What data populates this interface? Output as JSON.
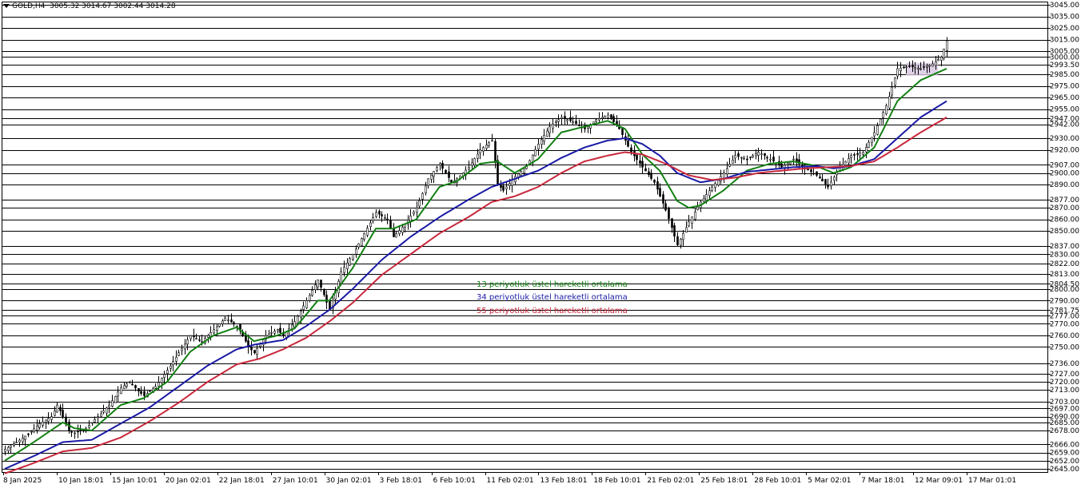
{
  "header": {
    "symbol": "GOLD,H4",
    "ohlc": "3005.32 3014.67 3002.44 3014.28"
  },
  "legend": {
    "ema13": "13 periyotluk üstel hareketli ortalama",
    "ema34": "34 periyotluk üstel hareketli ortalama",
    "ema55": "55 periyotluk üstel hareketli ortalama"
  },
  "colors": {
    "background": "#ffffff",
    "candle": "#000000",
    "ema13": "#138013",
    "ema34": "#1a1aa6",
    "ema55": "#c8283c",
    "highlight_box": "#d7c7e0"
  },
  "chart_data": {
    "type": "line",
    "xlabel": "",
    "ylabel": "",
    "ylim": [
      2645,
      3045
    ],
    "y_tick_labels": [
      "3045.00",
      "3035.00",
      "3025.00",
      "3015.00",
      "3005.00",
      "3000.00",
      "2993.50",
      "2985.00",
      "2975.00",
      "2965.00",
      "2955.00",
      "2947.00",
      "2942.00",
      "2930.00",
      "2920.00",
      "2907.00",
      "2900.00",
      "2890.00",
      "2877.00",
      "2870.00",
      "2860.00",
      "2850.00",
      "2837.00",
      "2830.00",
      "2822.00",
      "2813.00",
      "2804.50",
      "2800.00",
      "2790.00",
      "2781.75",
      "2777.00",
      "2770.00",
      "2760.00",
      "2750.00",
      "2736.00",
      "2727.00",
      "2720.00",
      "2713.00",
      "2703.00",
      "2697.00",
      "2690.00",
      "2685.00",
      "2678.00",
      "2666.00",
      "2659.00",
      "2652.00",
      "2645.00"
    ],
    "hlines": [
      3045,
      3035,
      3025,
      3015,
      3005,
      3000,
      2993.5,
      2985,
      2975,
      2965,
      2955,
      2947,
      2942,
      2930,
      2920,
      2907,
      2900,
      2890,
      2877,
      2870,
      2860,
      2850,
      2837,
      2830,
      2822,
      2813,
      2804.5,
      2800,
      2790,
      2781.75,
      2777,
      2770,
      2760,
      2750,
      2736,
      2727,
      2720,
      2713,
      2703,
      2697,
      2690,
      2685,
      2678,
      2666,
      2659,
      2652,
      2645
    ],
    "x_tick_labels": [
      "8 Jan 2025",
      "10 Jan 18:01",
      "15 Jan 10:01",
      "20 Jan 02:01",
      "22 Jan 18:01",
      "27 Jan 10:01",
      "30 Jan 02:01",
      "3 Feb 18:01",
      "6 Feb 10:01",
      "11 Feb 02:01",
      "13 Feb 18:01",
      "18 Feb 10:01",
      "21 Feb 02:01",
      "25 Feb 18:01",
      "28 Feb 10:01",
      "5 Mar 02:01",
      "7 Mar 18:01",
      "12 Mar 09:01",
      "17 Mar 01:01"
    ],
    "close_anchors": [
      [
        0,
        2662
      ],
      [
        4,
        2668
      ],
      [
        8,
        2675
      ],
      [
        12,
        2684
      ],
      [
        16,
        2690
      ],
      [
        18,
        2700
      ],
      [
        20,
        2690
      ],
      [
        22,
        2678
      ],
      [
        24,
        2676
      ],
      [
        28,
        2680
      ],
      [
        32,
        2690
      ],
      [
        36,
        2700
      ],
      [
        40,
        2715
      ],
      [
        43,
        2720
      ],
      [
        46,
        2712
      ],
      [
        48,
        2708
      ],
      [
        52,
        2716
      ],
      [
        56,
        2730
      ],
      [
        60,
        2745
      ],
      [
        64,
        2760
      ],
      [
        68,
        2755
      ],
      [
        72,
        2765
      ],
      [
        76,
        2775
      ],
      [
        80,
        2768
      ],
      [
        82,
        2760
      ],
      [
        84,
        2750
      ],
      [
        86,
        2745
      ],
      [
        90,
        2760
      ],
      [
        94,
        2765
      ],
      [
        96,
        2760
      ],
      [
        100,
        2772
      ],
      [
        104,
        2790
      ],
      [
        108,
        2808
      ],
      [
        110,
        2795
      ],
      [
        112,
        2782
      ],
      [
        116,
        2815
      ],
      [
        120,
        2830
      ],
      [
        124,
        2848
      ],
      [
        128,
        2866
      ],
      [
        132,
        2860
      ],
      [
        134,
        2845
      ],
      [
        138,
        2856
      ],
      [
        142,
        2870
      ],
      [
        146,
        2895
      ],
      [
        150,
        2908
      ],
      [
        152,
        2900
      ],
      [
        154,
        2892
      ],
      [
        156,
        2895
      ],
      [
        160,
        2905
      ],
      [
        164,
        2920
      ],
      [
        168,
        2928
      ],
      [
        170,
        2890
      ],
      [
        172,
        2885
      ],
      [
        176,
        2897
      ],
      [
        180,
        2906
      ],
      [
        184,
        2925
      ],
      [
        188,
        2940
      ],
      [
        192,
        2948
      ],
      [
        196,
        2944
      ],
      [
        200,
        2938
      ],
      [
        204,
        2946
      ],
      [
        208,
        2950
      ],
      [
        212,
        2938
      ],
      [
        216,
        2918
      ],
      [
        220,
        2905
      ],
      [
        224,
        2892
      ],
      [
        228,
        2868
      ],
      [
        232,
        2838
      ],
      [
        236,
        2858
      ],
      [
        240,
        2875
      ],
      [
        244,
        2888
      ],
      [
        248,
        2900
      ],
      [
        252,
        2915
      ],
      [
        256,
        2912
      ],
      [
        260,
        2918
      ],
      [
        264,
        2912
      ],
      [
        268,
        2905
      ],
      [
        272,
        2912
      ],
      [
        276,
        2904
      ],
      [
        280,
        2898
      ],
      [
        284,
        2888
      ],
      [
        288,
        2905
      ],
      [
        292,
        2915
      ],
      [
        296,
        2918
      ],
      [
        300,
        2935
      ],
      [
        304,
        2958
      ],
      [
        308,
        2990
      ],
      [
        312,
        2992
      ],
      [
        316,
        2990
      ],
      [
        320,
        2994
      ],
      [
        323,
        3000
      ],
      [
        325,
        3014
      ]
    ],
    "series": [
      {
        "name": "13 periyotluk üstel hareketli ortalama",
        "anchors": [
          [
            0,
            2652
          ],
          [
            10,
            2668
          ],
          [
            20,
            2685
          ],
          [
            24,
            2680
          ],
          [
            30,
            2678
          ],
          [
            40,
            2700
          ],
          [
            48,
            2706
          ],
          [
            56,
            2720
          ],
          [
            64,
            2746
          ],
          [
            72,
            2760
          ],
          [
            80,
            2767
          ],
          [
            86,
            2755
          ],
          [
            94,
            2760
          ],
          [
            100,
            2766
          ],
          [
            108,
            2790
          ],
          [
            112,
            2790
          ],
          [
            120,
            2818
          ],
          [
            128,
            2852
          ],
          [
            134,
            2852
          ],
          [
            142,
            2860
          ],
          [
            150,
            2888
          ],
          [
            156,
            2893
          ],
          [
            164,
            2908
          ],
          [
            170,
            2910
          ],
          [
            176,
            2900
          ],
          [
            184,
            2912
          ],
          [
            192,
            2935
          ],
          [
            200,
            2940
          ],
          [
            208,
            2945
          ],
          [
            214,
            2938
          ],
          [
            220,
            2916
          ],
          [
            226,
            2902
          ],
          [
            232,
            2876
          ],
          [
            236,
            2870
          ],
          [
            240,
            2872
          ],
          [
            248,
            2885
          ],
          [
            256,
            2902
          ],
          [
            264,
            2908
          ],
          [
            272,
            2910
          ],
          [
            280,
            2906
          ],
          [
            286,
            2900
          ],
          [
            292,
            2905
          ],
          [
            300,
            2922
          ],
          [
            308,
            2962
          ],
          [
            316,
            2980
          ],
          [
            325,
            2990
          ]
        ]
      },
      {
        "name": "34 periyotluk üstel hareketli ortalama",
        "anchors": [
          [
            0,
            2645
          ],
          [
            10,
            2656
          ],
          [
            20,
            2668
          ],
          [
            30,
            2670
          ],
          [
            40,
            2684
          ],
          [
            50,
            2698
          ],
          [
            60,
            2716
          ],
          [
            70,
            2734
          ],
          [
            80,
            2748
          ],
          [
            86,
            2752
          ],
          [
            96,
            2756
          ],
          [
            104,
            2768
          ],
          [
            112,
            2782
          ],
          [
            120,
            2800
          ],
          [
            130,
            2825
          ],
          [
            140,
            2845
          ],
          [
            150,
            2862
          ],
          [
            160,
            2877
          ],
          [
            168,
            2888
          ],
          [
            176,
            2895
          ],
          [
            184,
            2902
          ],
          [
            192,
            2913
          ],
          [
            200,
            2922
          ],
          [
            208,
            2928
          ],
          [
            214,
            2930
          ],
          [
            220,
            2925
          ],
          [
            226,
            2915
          ],
          [
            232,
            2900
          ],
          [
            240,
            2892
          ],
          [
            248,
            2895
          ],
          [
            256,
            2901
          ],
          [
            264,
            2903
          ],
          [
            272,
            2905
          ],
          [
            280,
            2906
          ],
          [
            286,
            2904
          ],
          [
            292,
            2906
          ],
          [
            300,
            2912
          ],
          [
            308,
            2930
          ],
          [
            316,
            2948
          ],
          [
            325,
            2962
          ]
        ]
      },
      {
        "name": "55 periyotluk üstel hareketli ortalama",
        "anchors": [
          [
            0,
            2641
          ],
          [
            10,
            2650
          ],
          [
            20,
            2660
          ],
          [
            30,
            2663
          ],
          [
            40,
            2672
          ],
          [
            50,
            2686
          ],
          [
            60,
            2702
          ],
          [
            70,
            2720
          ],
          [
            80,
            2735
          ],
          [
            88,
            2740
          ],
          [
            96,
            2748
          ],
          [
            104,
            2758
          ],
          [
            112,
            2772
          ],
          [
            120,
            2788
          ],
          [
            130,
            2812
          ],
          [
            140,
            2830
          ],
          [
            150,
            2848
          ],
          [
            160,
            2862
          ],
          [
            168,
            2875
          ],
          [
            176,
            2880
          ],
          [
            184,
            2888
          ],
          [
            192,
            2900
          ],
          [
            200,
            2910
          ],
          [
            208,
            2915
          ],
          [
            214,
            2918
          ],
          [
            220,
            2916
          ],
          [
            228,
            2908
          ],
          [
            236,
            2898
          ],
          [
            244,
            2894
          ],
          [
            252,
            2896
          ],
          [
            260,
            2900
          ],
          [
            268,
            2902
          ],
          [
            276,
            2904
          ],
          [
            284,
            2905
          ],
          [
            292,
            2906
          ],
          [
            300,
            2910
          ],
          [
            308,
            2922
          ],
          [
            316,
            2935
          ],
          [
            325,
            2948
          ]
        ]
      }
    ]
  }
}
